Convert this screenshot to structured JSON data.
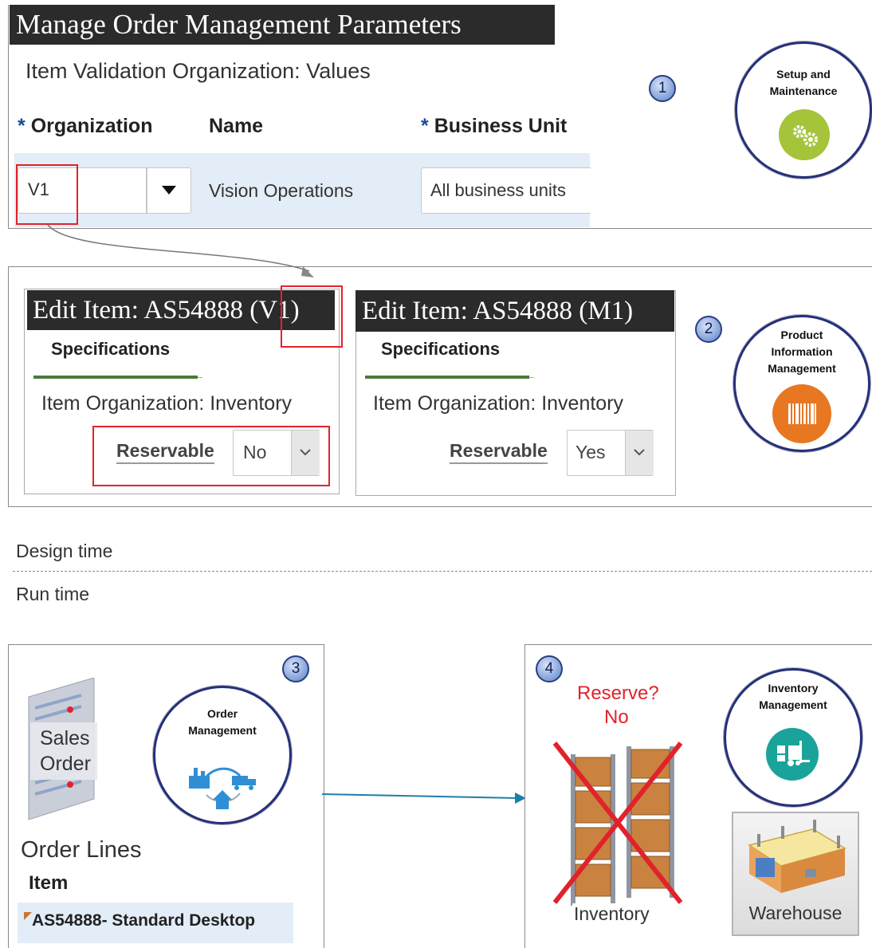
{
  "page_title": "Manage Order Management Parameters",
  "section1": {
    "subtitle": "Item Validation Organization: Values",
    "number": "1",
    "columns": {
      "required_mark": "*",
      "organization": "Organization",
      "name": "Name",
      "business_unit": "Business Unit"
    },
    "row": {
      "organization_value": "V1",
      "name_value": "Vision Operations",
      "business_unit_value": "All business units"
    },
    "badge": {
      "label_line1": "Setup and",
      "label_line2": "Maintenance",
      "icon": "gears-icon",
      "color": "#a5c43a"
    }
  },
  "section2": {
    "number": "2",
    "card_v1": {
      "title_prefix": "Edit Item: AS54888 ",
      "title_org": "(V1)",
      "tab": "Specifications",
      "org_line": "Item Organization: Inventory",
      "field_label": "Reservable",
      "field_value": "No"
    },
    "card_m1": {
      "title": "Edit Item: AS54888 (M1)",
      "tab": "Specifications",
      "org_line": "Item Organization: Inventory",
      "field_label": "Reservable",
      "field_value": "Yes"
    },
    "badge": {
      "line1": "Product",
      "line2": "Information",
      "line3": "Management",
      "icon": "barcode-icon",
      "color": "#e87722"
    }
  },
  "divider": {
    "design_time": "Design time",
    "run_time": "Run time"
  },
  "section3": {
    "number": "3",
    "sales_order_line1": "Sales",
    "sales_order_line2": "Order",
    "badge": {
      "line1": "Order",
      "line2": "Management",
      "icon": "factory-truck-house-icon",
      "color": "#2f8fd6"
    },
    "order_lines_title": "Order Lines",
    "item_header": "Item",
    "item_value": "AS54888- Standard Desktop"
  },
  "section4": {
    "number": "4",
    "reserve_question": "Reserve?",
    "reserve_answer": "No",
    "inventory_label": "Inventory",
    "badge": {
      "line1": "Inventory",
      "line2": "Management",
      "icon": "forklift-icon",
      "color": "#1aa39a"
    },
    "warehouse_label": "Warehouse"
  },
  "colors": {
    "accent_red": "#e0232b",
    "title_bg": "#2b2b2b",
    "tab_underline": "#4a7a3a",
    "row_highlight": "#e3edf8"
  }
}
